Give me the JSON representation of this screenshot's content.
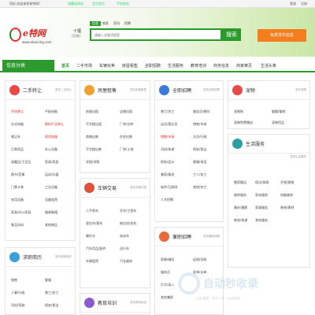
{
  "topbar": {
    "welcome": "您好,欢迎来到易特网!",
    "links": [
      "请登录",
      "免费注册"
    ],
    "mid_links": [
      "收藏此网站",
      "设为首页",
      "手机浏览"
    ],
    "right_links": [
      "登录",
      "注册"
    ]
  },
  "logo": {
    "text": "e特网",
    "url": "www.ebaixing.com"
  },
  "city": {
    "name": "十堰",
    "switch": "[切换]"
  },
  "search": {
    "tabs": [
      "信息",
      "商家",
      "资讯",
      "招聘"
    ],
    "placeholder": "请输入关键词搜索",
    "button": "搜索"
  },
  "post_button": "免费发布信息",
  "nav": {
    "category_label": "信息分类",
    "items": [
      "首页",
      "二手市场",
      "车辆买卖",
      "房屋租售",
      "全职招聘",
      "生活服务",
      "教育培训",
      "商务信息",
      "商家黄页",
      "生活头条"
    ]
  },
  "cards": {
    "secondhand": {
      "title": "二手转让",
      "more": "发布二手转让",
      "items": [
        "手机转让",
        "平板电脑",
        "台式电脑",
        "数码产品转让",
        "笔记本",
        "家用电器",
        "日常用品",
        "办公设备",
        "收藏品/工艺品",
        "家具/家居",
        "图书/音像",
        "运动/乐器",
        "门票卡券",
        "工业设备",
        "农用设备",
        "设备租赁",
        "家具/办公家具",
        "服装鞋帽",
        "食品饮料",
        "其他物品",
        "母婴用品",
        "网络转让"
      ]
    },
    "house": {
      "title": "房屋租售",
      "more": "发布房屋租售",
      "items": [
        "房屋出租",
        "店铺出租",
        "写字楼出租",
        "厂房/仓库",
        "商铺出售",
        "住宅出售",
        "写字楼出售",
        "厂房/土地",
        "求租/求购",
        "短租"
      ]
    },
    "jobs": {
      "title": "全职招聘",
      "more": "发布全职招聘",
      "items": [
        "普工/技工",
        "服务员/餐饮",
        "店员/营业员",
        "销售/市场",
        "文员/行政",
        "司机/快递",
        "保安/保洁",
        "财务/会计",
        "客服/电话",
        "美容/美发",
        "工人/技工",
        "软件/互联网",
        "其他/杂工",
        "人才招聘"
      ]
    },
    "pets": {
      "title": "宠物",
      "more": "发布宠物",
      "items": [
        "宠物狗",
        "猫猫/猫咪",
        "宠物免费赠送",
        "宠物用品",
        "其他宠物",
        "宠物食品"
      ]
    },
    "cars": {
      "title": "车辆交易",
      "more": "发布车辆交易",
      "items": [
        "二手轿车",
        "货车/工程车",
        "面包车/客车",
        "拖拉机/农机",
        "摩托车",
        "电动车",
        "汽车用品/配件",
        "自行车",
        "车辆租赁",
        "汽车维修"
      ]
    },
    "parttime": {
      "title": "兼职招聘",
      "more": "发布兼职招聘",
      "items": [
        "家教/辅导",
        "促销/导购",
        "服务员",
        "发单/派单",
        "打字/录入",
        "网络兼职",
        "其他兼职"
      ]
    },
    "services": {
      "title": "生活服务",
      "more": "发布生活服务",
      "items": [
        "搬家搬运",
        "保洁/保姆",
        "开锁/换锁",
        "维修服务",
        "家电维修",
        "电脑维修",
        "婚庆/摄影",
        "家政服务",
        "装修/建材",
        "物流/快递",
        "其他服务"
      ]
    },
    "jobseek": {
      "title": "求职简历",
      "more": "发布求职简历",
      "items": [
        "销售",
        "客服",
        "人事/行政",
        "普工/技工",
        "司机/驾驶",
        "保安/保洁",
        "美容/美发",
        "服务员",
        "教育/培训",
        "IT/计算机"
      ]
    },
    "edu": {
      "title": "教育培训",
      "more": "发布教育培训"
    }
  },
  "watermark": {
    "big": "自动秒收录",
    "small": "上线 链接 · 来访一次 · 自动收录"
  },
  "colors": {
    "accent": "#2d9a2d",
    "post": "#f47d1e"
  }
}
